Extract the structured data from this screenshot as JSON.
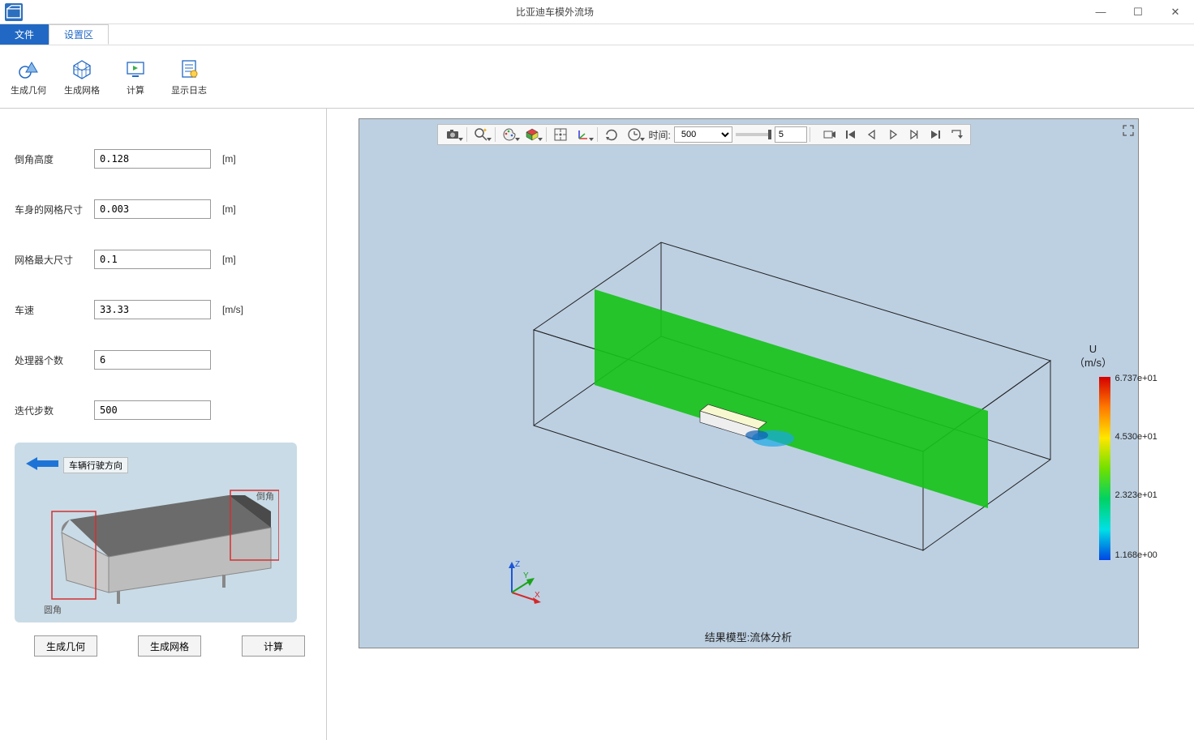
{
  "window": {
    "title": "比亚迪车模外流场"
  },
  "menu": {
    "file": "文件",
    "settings": "设置区"
  },
  "ribbon": {
    "gen_geom": "生成几何",
    "gen_mesh": "生成网格",
    "compute": "计算",
    "show_log": "显示日志"
  },
  "form": {
    "chamfer_height": {
      "label": "倒角高度",
      "value": "0.128",
      "unit": "[m]"
    },
    "body_mesh": {
      "label": "车身的网格尺寸",
      "value": "0.003",
      "unit": "[m]"
    },
    "max_mesh": {
      "label": "网格最大尺寸",
      "value": "0.1",
      "unit": "[m]"
    },
    "speed": {
      "label": "车速",
      "value": "33.33",
      "unit": "[m/s]"
    },
    "cores": {
      "label": "处理器个数",
      "value": "6",
      "unit": ""
    },
    "iters": {
      "label": "迭代步数",
      "value": "500",
      "unit": ""
    }
  },
  "diagram": {
    "direction": "车辆行驶方向",
    "chamfer": "倒角",
    "fillet": "圆角"
  },
  "actions": {
    "gen_geom": "生成几何",
    "gen_mesh": "生成网格",
    "compute": "计算"
  },
  "viewer": {
    "time_label": "时间:",
    "time_value": "500",
    "stride": "5",
    "caption": "结果模型:流体分析",
    "colorbar": {
      "title_line1": "U",
      "title_line2": "（m/s）",
      "ticks": [
        "6.737e+01",
        "4.530e+01",
        "2.323e+01",
        "1.168e+00"
      ]
    },
    "axes": {
      "x": "X",
      "y": "Y",
      "z": "Z"
    }
  }
}
